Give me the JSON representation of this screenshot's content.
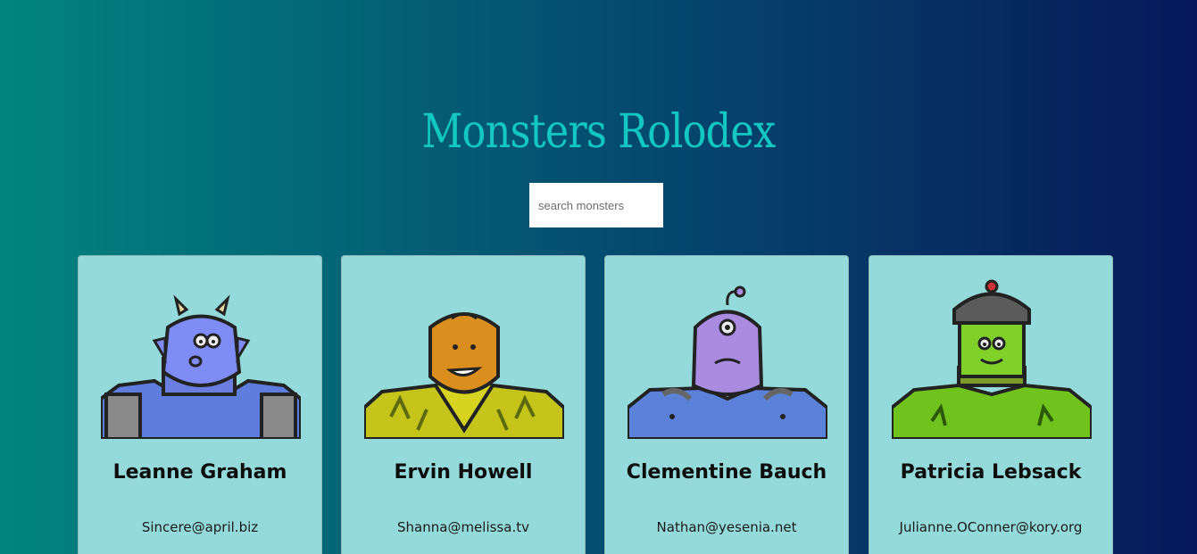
{
  "header": {
    "title": "Monsters Rolodex"
  },
  "search": {
    "placeholder": "search monsters"
  },
  "monsters": [
    {
      "name": "Leanne Graham",
      "email": "Sincere@april.biz",
      "skin": "#7f8cf5",
      "body": "#5f7ddc"
    },
    {
      "name": "Ervin Howell",
      "email": "Shanna@melissa.tv",
      "skin": "#d98e1e",
      "body": "#c5c41a"
    },
    {
      "name": "Clementine Bauch",
      "email": "Nathan@yesenia.net",
      "skin": "#a98be0",
      "body": "#5b82d8"
    },
    {
      "name": "Patricia Lebsack",
      "email": "Julianne.OConner@kory.org",
      "skin": "#7fd12a",
      "body": "#70c21c"
    }
  ]
}
